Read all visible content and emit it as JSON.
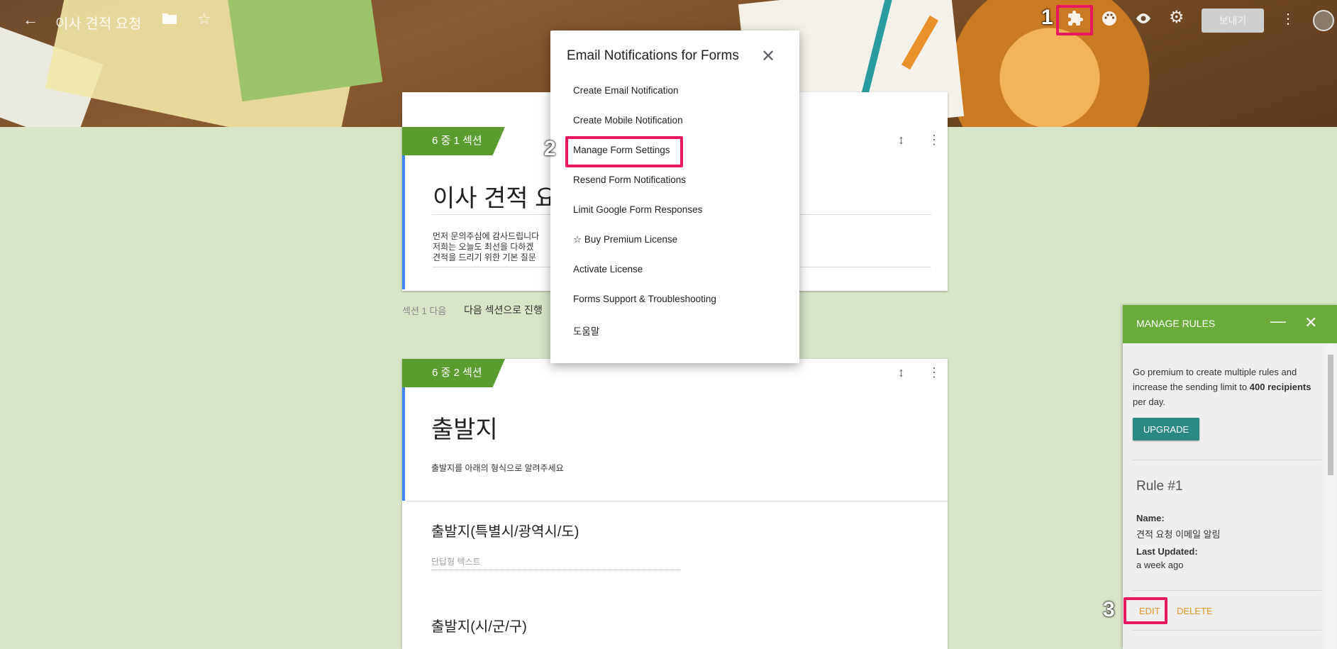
{
  "header": {
    "doc_title": "이사 견적 요청",
    "send_label": "보내기"
  },
  "annotations": {
    "step1": "1",
    "step2": "2",
    "step3": "3"
  },
  "sections": [
    {
      "tag": "6 중 1 섹션",
      "title": "이사 견적 요",
      "description": "먼저 문의주심에 감사드립니다\n저희는 오늘도 최선을 다하겠\n견적을 드리기 위한 기본 질문",
      "after_label": "섹션 1 다음",
      "after_value": "다음 섹션으로 진행"
    },
    {
      "tag": "6 중 2 섹션",
      "title": "출발지",
      "description": "출발지를 아래의 형식으로 알려주세요",
      "questions": [
        {
          "title": "출발지(특별시/광역시/도)",
          "placeholder": "단답형 텍스트"
        },
        {
          "title": "출발지(시/군/구)"
        }
      ]
    }
  ],
  "popup": {
    "title": "Email Notifications for Forms",
    "items": [
      "Create Email Notification",
      "Create Mobile Notification",
      "Manage Form Settings",
      "Resend Form Notifications",
      "Limit Google Form Responses",
      "☆ Buy Premium License",
      "Activate License",
      "Forms Support & Troubleshooting",
      "도움말"
    ]
  },
  "rules_panel": {
    "title": "MANAGE RULES",
    "promo_before": "Go premium to create multiple rules and increase the sending limit to ",
    "promo_bold": "400 recipients",
    "promo_after": " per day.",
    "upgrade_label": "UPGRADE",
    "rule": {
      "heading": "Rule #1",
      "name_label": "Name:",
      "name_value": "견적 요청 이메일 알림",
      "updated_label": "Last Updated:",
      "updated_value": "a week ago",
      "edit_label": "EDIT",
      "delete_label": "DELETE"
    }
  },
  "colors": {
    "accent_green": "#6aab3a",
    "highlight": "#e8185c",
    "upgrade": "#2a8a83",
    "link_orange": "#e6962a"
  }
}
